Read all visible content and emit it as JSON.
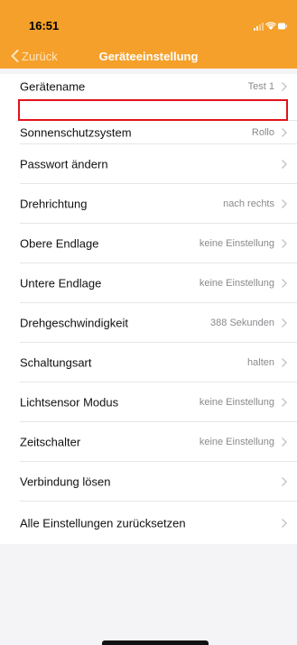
{
  "status_bar": {
    "time": "16:51"
  },
  "nav": {
    "back_label": "Zurück",
    "title": "Geräteeinstellung"
  },
  "rows": [
    {
      "label": "Gerätename",
      "value": "Test 1"
    },
    {
      "label": "Sonnenschutzsystem",
      "value": "Rollo"
    },
    {
      "label": "Passwort ändern",
      "value": ""
    },
    {
      "label": "Drehrichtung",
      "value": "nach rechts"
    },
    {
      "label": "Obere Endlage",
      "value": "keine Einstellung"
    },
    {
      "label": "Untere Endlage",
      "value": "keine Einstellung"
    },
    {
      "label": "Drehgeschwindigkeit",
      "value": "388 Sekunden"
    },
    {
      "label": "Schaltungsart",
      "value": "halten"
    },
    {
      "label": "Lichtsensor Modus",
      "value": "keine Einstellung"
    },
    {
      "label": "Zeitschalter",
      "value": "keine Einstellung"
    },
    {
      "label": "Verbindung lösen",
      "value": ""
    },
    {
      "label": "Alle Einstellungen zurücksetzen",
      "value": ""
    }
  ],
  "colors": {
    "header": "#f5a02a",
    "highlight_border": "#e3121b",
    "background": "#f4f4f6"
  }
}
